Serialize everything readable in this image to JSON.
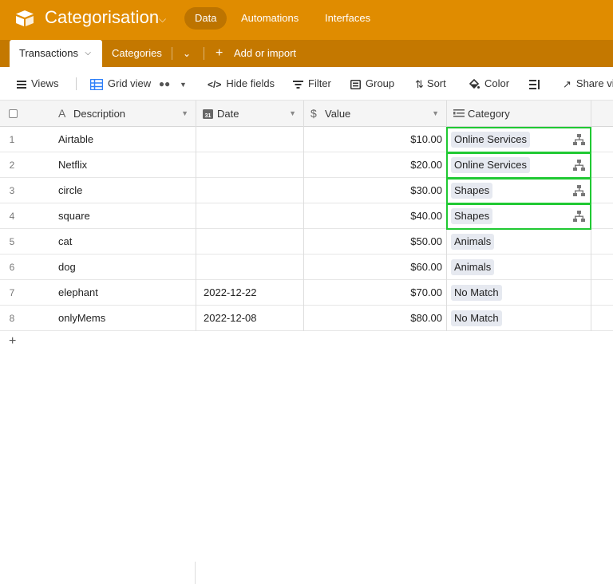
{
  "app": {
    "base_title": "Categorisation",
    "brand_color": "#e08c00",
    "nav": [
      {
        "label": "Data",
        "active": true
      },
      {
        "label": "Automations",
        "active": false
      },
      {
        "label": "Interfaces",
        "active": false
      }
    ]
  },
  "tabs": {
    "active": "Transactions",
    "other": "Categories",
    "add": "Add or import"
  },
  "toolbar": {
    "views": "Views",
    "grid_view": "Grid view",
    "hide_fields": "Hide fields",
    "filter": "Filter",
    "group": "Group",
    "sort": "Sort",
    "color": "Color",
    "share": "Share view"
  },
  "columns": {
    "description": "Description",
    "date": "Date",
    "value": "Value",
    "category": "Category"
  },
  "rows": [
    {
      "n": "1",
      "description": "Airtable",
      "date": "",
      "value": "$10.00",
      "category": "Online Services",
      "linked": true
    },
    {
      "n": "2",
      "description": "Netflix",
      "date": "",
      "value": "$20.00",
      "category": "Online Services",
      "linked": true
    },
    {
      "n": "3",
      "description": "circle",
      "date": "",
      "value": "$30.00",
      "category": "Shapes",
      "linked": true
    },
    {
      "n": "4",
      "description": "square",
      "date": "",
      "value": "$40.00",
      "category": "Shapes",
      "linked": true
    },
    {
      "n": "5",
      "description": "cat",
      "date": "",
      "value": "$50.00",
      "category": "Animals",
      "linked": false
    },
    {
      "n": "6",
      "description": "dog",
      "date": "",
      "value": "$60.00",
      "category": "Animals",
      "linked": false
    },
    {
      "n": "7",
      "description": "elephant",
      "date": "2022-12-22",
      "value": "$70.00",
      "category": "No Match",
      "linked": false
    },
    {
      "n": "8",
      "description": "onlyMems",
      "date": "2022-12-08",
      "value": "$80.00",
      "category": "No Match",
      "linked": false
    }
  ],
  "add_row_symbol": "+"
}
